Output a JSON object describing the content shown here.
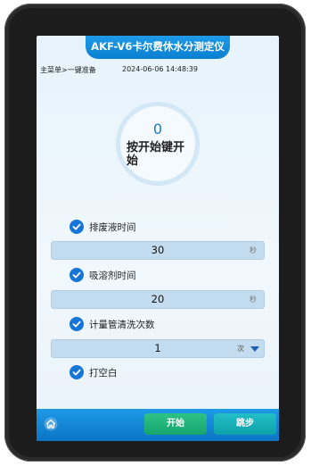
{
  "header": {
    "title": "AKF-V6卡尔费休水分测定仪"
  },
  "breadcrumb": "主菜单>一键准备",
  "datetime": "2024-06-06 14:48:39",
  "dial": {
    "value": "0",
    "label": "按开始键开始"
  },
  "options": [
    {
      "label": "排废液时间",
      "checked": true,
      "value": "30",
      "unit": "秒"
    },
    {
      "label": "吸溶剂时间",
      "checked": true,
      "value": "20",
      "unit": "秒"
    },
    {
      "label": "计量管清洗次数",
      "checked": true,
      "value": "1",
      "unit": "次"
    },
    {
      "label": "打空白",
      "checked": true
    }
  ],
  "footer": {
    "start_label": "开始",
    "skip_label": "跳步",
    "home_icon": "home-icon"
  },
  "colors": {
    "accent": "#0a7fd0",
    "start": "#17a46d",
    "skip": "#0ea0aa",
    "check": "#1676d8"
  }
}
